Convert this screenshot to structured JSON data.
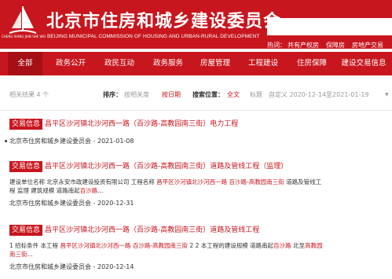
{
  "header": {
    "logo_caption": "CHENG XIANG JIAN SHE WEI",
    "title": "北京市住房和城乡建设委员会",
    "subtitle": "BEIJING MUNICIPAL COMMISSION OF HOUSING AND URBAN-RURAL DEVELOPMENT",
    "search_placeholder": "",
    "hotwords_label": "热词：",
    "hotwords": [
      "共有产权房",
      "保障房",
      "房地产交易"
    ]
  },
  "nav": {
    "items": [
      "全部",
      "政务公开",
      "政民互动",
      "政务服务",
      "房屋管理",
      "工程建设",
      "住房保障",
      "建设交易信息"
    ]
  },
  "toolbar": {
    "result_count": "相关结果 4 个",
    "sort_label": "排序：",
    "sort_relevance": "按相关度",
    "sort_date": "按日期",
    "scope_label": "搜索位置：",
    "scope_all": "全文",
    "scope_title": "标题",
    "date_range": "自定义 2020-12-14至2021-01-19",
    "dropdown_glyph": "▼"
  },
  "results": [
    {
      "tag": "交易信息",
      "title_hl": "昌平区沙河镇北沙河西一路（百沙路-高教园南三街）",
      "title_rest": "电力工程",
      "snippet": [],
      "source": "北京市住房和城乡建设委员会",
      "date": "2021-01-08"
    },
    {
      "tag": "交易信息",
      "title_hl": "昌平区沙河镇北沙河西一路（百沙路-高教园南三街）",
      "title_rest": "道路及管线工程（监理）",
      "snippet": [
        [
          {
            "t": "建设单位名称 北京永安市政建设投资有限公司 工程名称 ",
            "h": false
          },
          {
            "t": "昌平区沙河镇北沙河西一路 百沙路-高教园南三街",
            "h": true
          },
          {
            "t": " 道路及管线工",
            "h": false
          }
        ],
        [
          {
            "t": "程 监理 建筑规模 道路南起",
            "h": false
          },
          {
            "t": "百沙路",
            "h": true
          },
          {
            "t": "...",
            "h": false
          }
        ]
      ],
      "source": "北京市住房和城乡建设委员会",
      "date": "2020-12-31"
    },
    {
      "tag": "交易信息",
      "title_hl": "昌平区沙河镇北沙河西一路（百沙路-高教园南三街）",
      "title_rest": "道路及管线工程",
      "snippet": [
        [
          {
            "t": "1 招标条件 本工程 ",
            "h": false
          },
          {
            "t": "昌平区沙河镇北沙河西一路 百沙路-高教园南三街",
            "h": true
          },
          {
            "t": " 2 2 本工程的建设规模 道路南起",
            "h": false
          },
          {
            "t": "百沙路",
            "h": true
          },
          {
            "t": " 北至",
            "h": false
          },
          {
            "t": "高教园",
            "h": true
          }
        ],
        [
          {
            "t": "南三街",
            "h": true
          },
          {
            "t": "...",
            "h": false
          }
        ]
      ],
      "source": "北京市住房和城乡建设委员会",
      "date": "2020-12-14"
    }
  ],
  "colors": {
    "brand_red": "#c8161e",
    "active_nav": "#a50f15"
  }
}
